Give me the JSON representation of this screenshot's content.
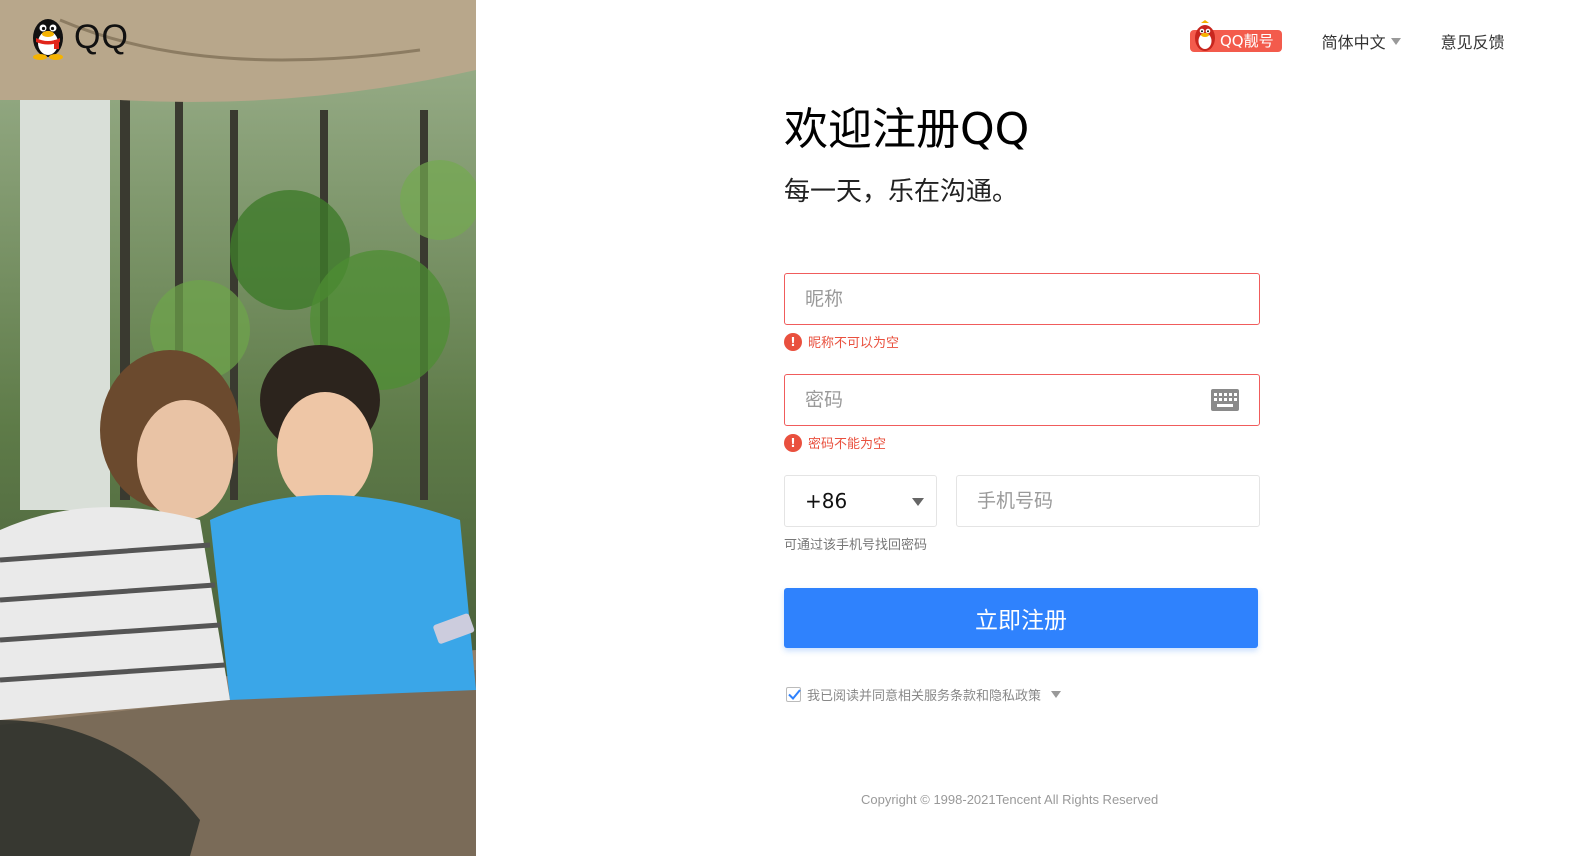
{
  "logo": {
    "text": "QQ"
  },
  "topnav": {
    "pretty_number": "QQ靓号",
    "language": "简体中文",
    "feedback": "意见反馈"
  },
  "form": {
    "title": "欢迎注册QQ",
    "subtitle": "每一天，乐在沟通。",
    "nickname": {
      "placeholder": "昵称",
      "value": "",
      "error": "昵称不可以为空"
    },
    "password": {
      "placeholder": "密码",
      "value": "",
      "error": "密码不能为空"
    },
    "country_code": "+86",
    "phone": {
      "placeholder": "手机号码",
      "value": ""
    },
    "phone_hint": "可通过该手机号找回密码",
    "submit_label": "立即注册",
    "agreement": {
      "checked": true,
      "text": "我已阅读并同意相关服务条款和隐私政策"
    }
  },
  "footer": {
    "copyright": "Copyright © 1998-2021Tencent All Rights Reserved"
  },
  "colors": {
    "primary": "#2f82fd",
    "error": "#e9503e",
    "badge": "#f35b4c"
  },
  "icons": [
    "qq-penguin-icon",
    "keyboard-icon",
    "error-icon",
    "checkmark-icon",
    "chevron-down-icon"
  ]
}
